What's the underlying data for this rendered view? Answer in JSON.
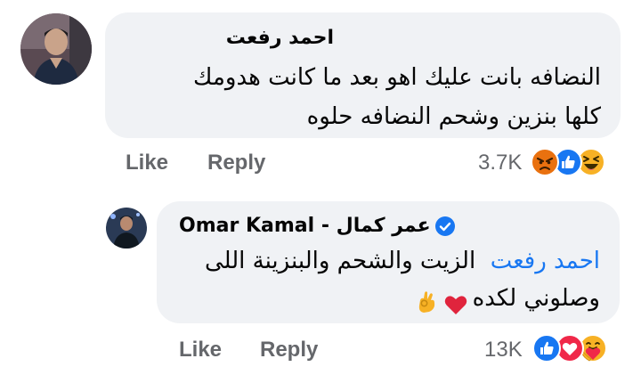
{
  "comment": {
    "author": "احمد رفعت",
    "text_line1": "النضافه بانت عليك اهو بعد ما كانت هدومك",
    "text_line2": "كلها بنزين وشحم النضافه حلوه",
    "like_label": "Like",
    "reply_label": "Reply",
    "reaction_count": "3.7K",
    "reactions": [
      "angry-icon",
      "like-icon",
      "haha-icon"
    ]
  },
  "reply": {
    "author_latin": "Omar Kamal",
    "author_separator": " - ",
    "author_arabic": "عمر كمال",
    "verified": true,
    "mention": "احمد رفعت",
    "text_line1": "الزيت والشحم والبنزينة اللى",
    "text_line2": "وصلوني لكده",
    "emojis": [
      "ok-hand-icon",
      "red-heart-icon"
    ],
    "like_label": "Like",
    "reply_label": "Reply",
    "reaction_count": "13K",
    "reactions": [
      "like-icon",
      "love-icon",
      "care-icon"
    ]
  },
  "colors": {
    "bubble": "#f0f2f5",
    "link": "#1877f2",
    "meta_text": "#65676b",
    "like_blue": "#1877f2",
    "love_red": "#f02849",
    "angry_orange": "#e9710f",
    "haha_yellow": "#f7b125"
  }
}
